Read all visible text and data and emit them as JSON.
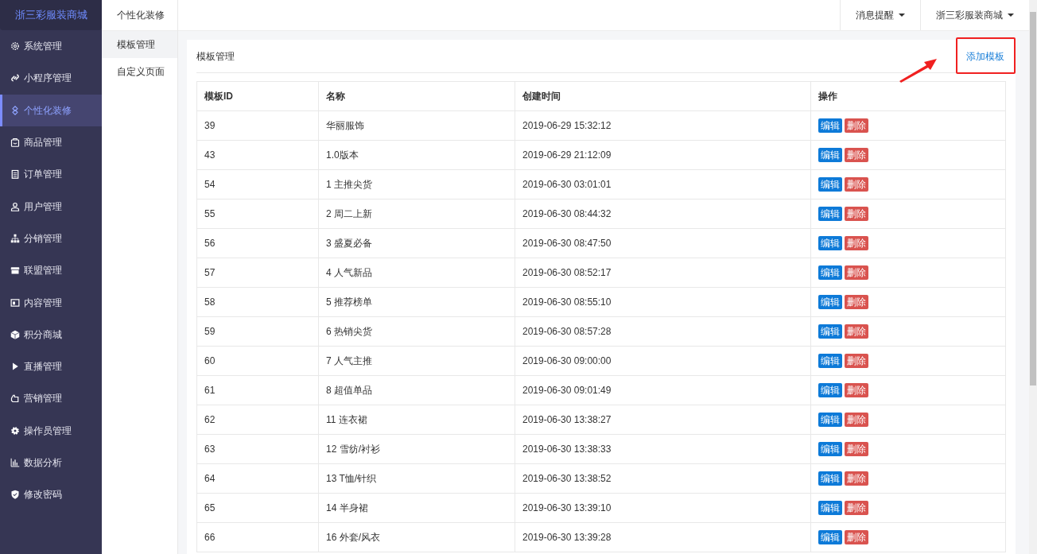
{
  "brand": "浙三彩服装商城",
  "sidebar": {
    "items": [
      {
        "label": "系统管理",
        "selected": false
      },
      {
        "label": "小程序管理",
        "selected": false
      },
      {
        "label": "个性化装修",
        "selected": true
      },
      {
        "label": "商品管理",
        "selected": false
      },
      {
        "label": "订单管理",
        "selected": false
      },
      {
        "label": "用户管理",
        "selected": false
      },
      {
        "label": "分销管理",
        "selected": false
      },
      {
        "label": "联盟管理",
        "selected": false
      },
      {
        "label": "内容管理",
        "selected": false
      },
      {
        "label": "积分商城",
        "selected": false
      },
      {
        "label": "直播管理",
        "selected": false
      },
      {
        "label": "营销管理",
        "selected": false
      },
      {
        "label": "操作员管理",
        "selected": false
      },
      {
        "label": "数据分析",
        "selected": false
      },
      {
        "label": "修改密码",
        "selected": false
      }
    ]
  },
  "subnav": {
    "title": "个性化装修",
    "items": [
      {
        "label": "模板管理",
        "selected": true
      },
      {
        "label": "自定义页面",
        "selected": false
      }
    ]
  },
  "topbar": {
    "menus": [
      "消息提醒",
      "浙三彩服装商城"
    ]
  },
  "card": {
    "title": "模板管理",
    "add_button": "添加模板",
    "table": {
      "columns": [
        "模板ID",
        "名称",
        "创建时间",
        "操作"
      ],
      "rows": [
        {
          "id": "39",
          "name": "华丽服饰",
          "created": "2019-06-29 15:32:12",
          "edit": "编辑",
          "delete": "删除"
        },
        {
          "id": "43",
          "name": "1.0版本",
          "created": "2019-06-29 21:12:09",
          "edit": "编辑",
          "delete": "删除"
        },
        {
          "id": "54",
          "name": "1 主推尖货",
          "created": "2019-06-30 03:01:01",
          "edit": "编辑",
          "delete": "删除"
        },
        {
          "id": "55",
          "name": "2 周二上新",
          "created": "2019-06-30 08:44:32",
          "edit": "编辑",
          "delete": "删除"
        },
        {
          "id": "56",
          "name": "3 盛夏必备",
          "created": "2019-06-30 08:47:50",
          "edit": "编辑",
          "delete": "删除"
        },
        {
          "id": "57",
          "name": "4 人气新品",
          "created": "2019-06-30 08:52:17",
          "edit": "编辑",
          "delete": "删除"
        },
        {
          "id": "58",
          "name": "5 推荐榜单",
          "created": "2019-06-30 08:55:10",
          "edit": "编辑",
          "delete": "删除"
        },
        {
          "id": "59",
          "name": "6 热销尖货",
          "created": "2019-06-30 08:57:28",
          "edit": "编辑",
          "delete": "删除"
        },
        {
          "id": "60",
          "name": "7 人气主推",
          "created": "2019-06-30 09:00:00",
          "edit": "编辑",
          "delete": "删除"
        },
        {
          "id": "61",
          "name": "8 超值单品",
          "created": "2019-06-30 09:01:49",
          "edit": "编辑",
          "delete": "删除"
        },
        {
          "id": "62",
          "name": "11 连衣裙",
          "created": "2019-06-30 13:38:27",
          "edit": "编辑",
          "delete": "删除"
        },
        {
          "id": "63",
          "name": "12 雪纺/衬衫",
          "created": "2019-06-30 13:38:33",
          "edit": "编辑",
          "delete": "删除"
        },
        {
          "id": "64",
          "name": "13 T恤/针织",
          "created": "2019-06-30 13:38:52",
          "edit": "编辑",
          "delete": "删除"
        },
        {
          "id": "65",
          "name": "14 半身裙",
          "created": "2019-06-30 13:39:10",
          "edit": "编辑",
          "delete": "删除"
        },
        {
          "id": "66",
          "name": "16 外套/风衣",
          "created": "2019-06-30 13:39:28",
          "edit": "编辑",
          "delete": "删除"
        }
      ]
    }
  }
}
